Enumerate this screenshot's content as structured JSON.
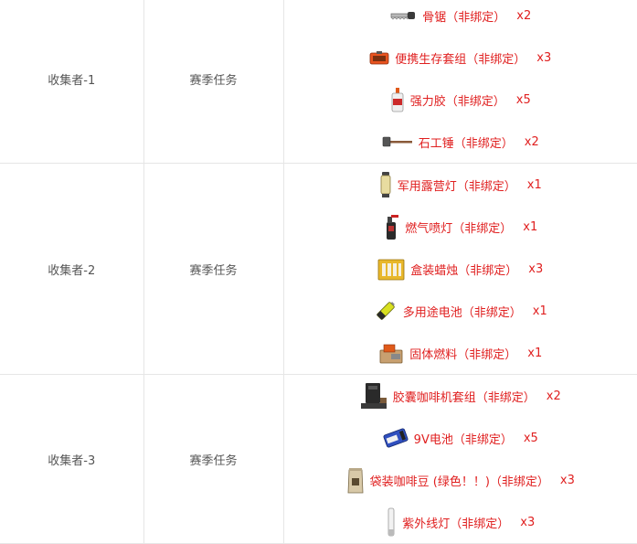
{
  "rows": [
    {
      "name": "收集者-1",
      "type": "赛季任务",
      "items": [
        {
          "icon": "bone-saw-icon",
          "name": "骨锯（非绑定）",
          "qty": "x2"
        },
        {
          "icon": "survival-kit-icon",
          "name": "便携生存套组（非绑定）",
          "qty": "x3"
        },
        {
          "icon": "glue-bottle-icon",
          "name": "强力胶（非绑定）",
          "qty": "x5"
        },
        {
          "icon": "sledgehammer-icon",
          "name": "石工锤（非绑定）",
          "qty": "x2"
        }
      ]
    },
    {
      "name": "收集者-2",
      "type": "赛季任务",
      "items": [
        {
          "icon": "camping-lantern-icon",
          "name": "军用露营灯（非绑定）",
          "qty": "x1"
        },
        {
          "icon": "blowtorch-icon",
          "name": "燃气喷灯（非绑定）",
          "qty": "x1"
        },
        {
          "icon": "candle-box-icon",
          "name": "盒装蜡烛（非绑定）",
          "qty": "x3"
        },
        {
          "icon": "battery-icon",
          "name": "多用途电池（非绑定）",
          "qty": "x1"
        },
        {
          "icon": "solid-fuel-icon",
          "name": "固体燃料（非绑定）",
          "qty": "x1"
        }
      ]
    },
    {
      "name": "收集者-3",
      "type": "赛季任务",
      "items": [
        {
          "icon": "coffee-machine-icon",
          "name": "胶囊咖啡机套组（非绑定）",
          "qty": "x2"
        },
        {
          "icon": "9v-battery-icon",
          "name": "9V电池（非绑定）",
          "qty": "x5"
        },
        {
          "icon": "coffee-bag-icon",
          "name": "袋装咖啡豆 (绿色！！)（非绑定）",
          "qty": "x3"
        },
        {
          "icon": "uv-lamp-icon",
          "name": "紫外线灯（非绑定）",
          "qty": "x3"
        }
      ]
    }
  ]
}
